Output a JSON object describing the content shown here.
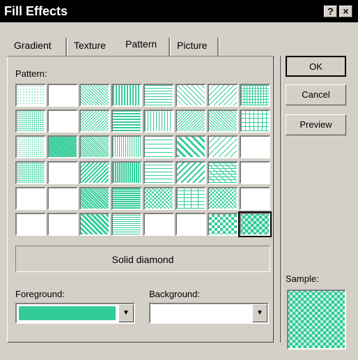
{
  "window": {
    "title": "Fill Effects",
    "help_label": "?",
    "close_label": "×"
  },
  "tabs": [
    {
      "label": "Gradient",
      "active": false
    },
    {
      "label": "Texture",
      "active": false
    },
    {
      "label": "Pattern",
      "active": true
    },
    {
      "label": "Picture",
      "active": false
    }
  ],
  "pattern": {
    "label": "Pattern:",
    "rows": 6,
    "cols": 8,
    "selected_index": 47,
    "selected_name": "Solid diamond"
  },
  "foreground": {
    "label": "Foreground:",
    "color": "#33cc99"
  },
  "background": {
    "label": "Background:",
    "color": "#ffffff"
  },
  "buttons": {
    "ok": "OK",
    "cancel": "Cancel",
    "preview": "Preview"
  },
  "sample": {
    "label": "Sample:"
  },
  "colors": {
    "accent": "#33cc99",
    "dialog_bg": "#d4d0c8",
    "titlebar": "#000000"
  }
}
